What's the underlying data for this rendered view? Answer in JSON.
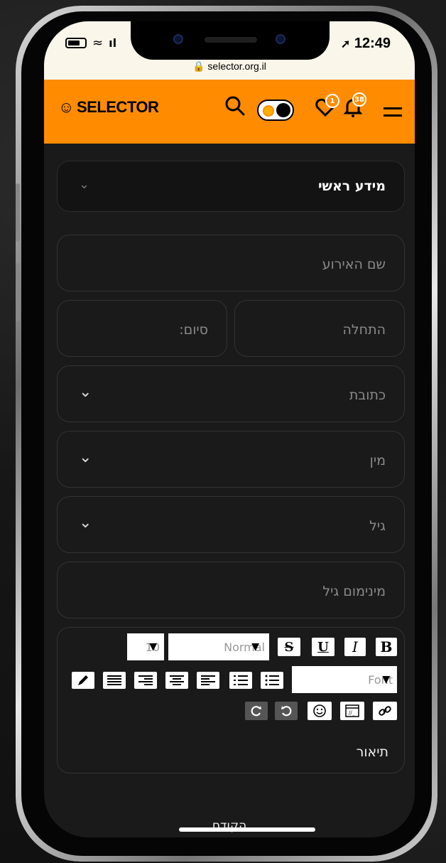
{
  "status_bar": {
    "time": "12:49",
    "url": "selector.org.il",
    "signal_text": "l"
  },
  "header": {
    "brand": "SELECTOR",
    "favorites_count": "1",
    "notifications_count": "38",
    "colors": {
      "bar": "#ff8c00",
      "badge": "#ff8c00"
    }
  },
  "form": {
    "section_title": "מידע ראשי",
    "event_name_placeholder": "שם האירוע",
    "start_placeholder": "התחלה",
    "end_placeholder": "סיום:",
    "address_label": "כתובת",
    "gender_label": "מין",
    "age_label": "גיל",
    "min_age_placeholder": "מינימום גיל",
    "description_label": "תיאור"
  },
  "editor_toolbar": {
    "bold": "B",
    "italic": "I",
    "underline": "U",
    "strike": "S",
    "style_select": "Normal",
    "size_select": "10",
    "font_select": "Font"
  },
  "footer": {
    "prev_label": "הקודם"
  },
  "icons": [
    "search-icon",
    "theme-toggle",
    "heart-icon",
    "bell-icon",
    "menu-icon",
    "chevron-down-icon",
    "pencil-icon",
    "align-justify-icon",
    "align-right-icon",
    "align-center-icon",
    "align-left-icon",
    "ordered-list-icon",
    "bullet-list-icon",
    "redo-icon",
    "undo-icon",
    "emoji-icon",
    "code-icon",
    "link-icon"
  ]
}
